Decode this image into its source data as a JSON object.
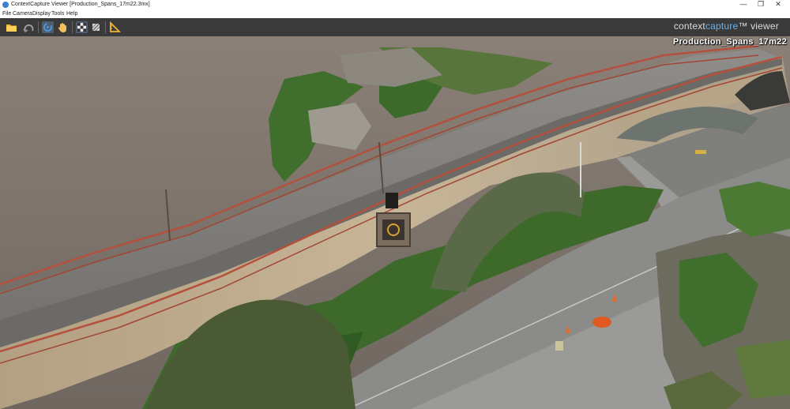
{
  "window": {
    "title": "ContextCapture Viewer [Production_Spans_17m22.3mx]",
    "minimize_glyph": "—",
    "maximize_glyph": "❐",
    "close_glyph": "✕"
  },
  "menu": [
    "File",
    "Camera",
    "Display",
    "Tools",
    "Help"
  ],
  "toolbar": {
    "buttons": [
      "open-folder-icon",
      "orbit-icon",
      "rotate-icon",
      "pan-hand-icon",
      "checkerboard-icon",
      "layers-icon",
      "measure-icon"
    ]
  },
  "brand": {
    "context": "context",
    "capture": "capture",
    "tm_viewer": "™ viewer"
  },
  "scene": {
    "label": "Production_Spans_17m22"
  },
  "colors": {
    "toolbar": "#3a3a3a",
    "brand_accent": "#6cb0e6",
    "background": "#7a7069"
  }
}
